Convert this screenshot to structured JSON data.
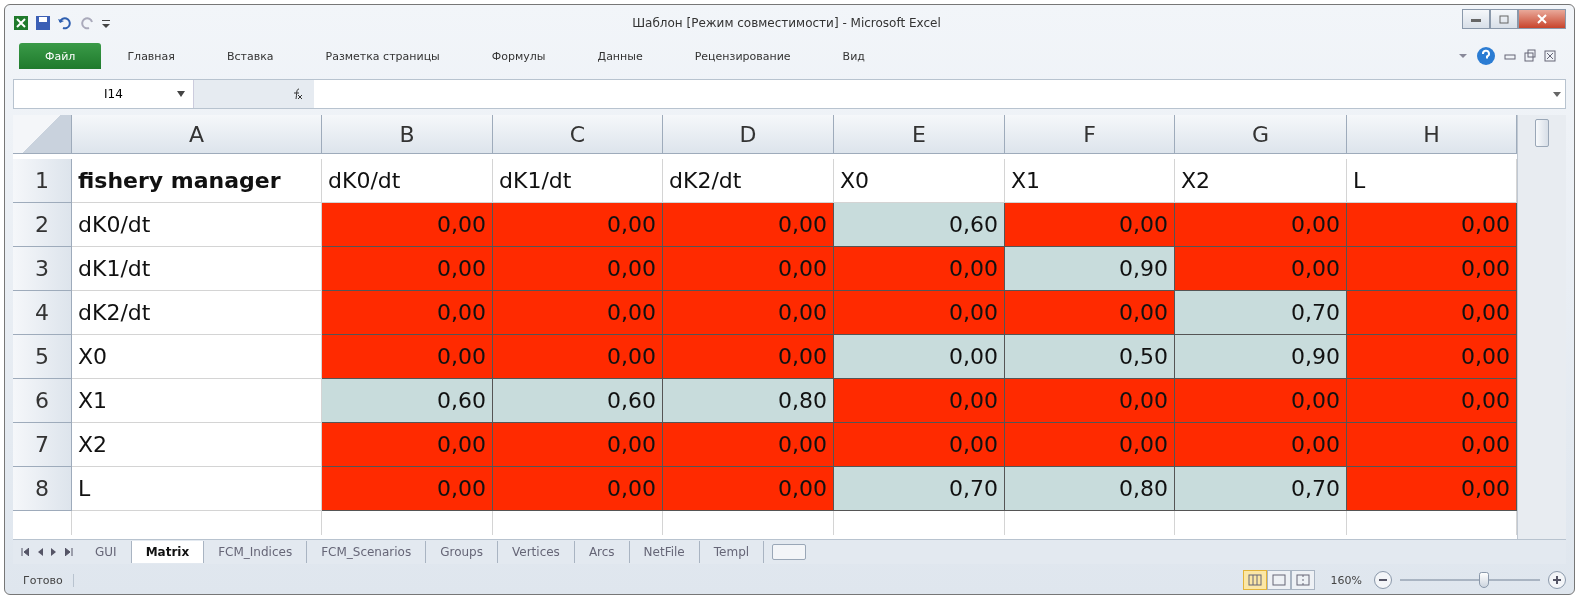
{
  "window": {
    "title": "Шаблон  [Режим совместимости]  -  Microsoft Excel"
  },
  "ribbon_tabs": [
    {
      "label": "Файл",
      "kind": "file"
    },
    {
      "label": "Главная",
      "kind": "tab"
    },
    {
      "label": "Вставка",
      "kind": "tab"
    },
    {
      "label": "Разметка страницы",
      "kind": "tab"
    },
    {
      "label": "Формулы",
      "kind": "tab"
    },
    {
      "label": "Данные",
      "kind": "tab"
    },
    {
      "label": "Рецензирование",
      "kind": "tab"
    },
    {
      "label": "Вид",
      "kind": "tab"
    }
  ],
  "formula_bar": {
    "name_box": "I14"
  },
  "columns": [
    "A",
    "B",
    "C",
    "D",
    "E",
    "F",
    "G",
    "H"
  ],
  "header_row": {
    "number": "1",
    "cells": [
      {
        "text": "fishery manager"
      },
      {
        "text": "dK0/dt"
      },
      {
        "text": "dK1/dt"
      },
      {
        "text": "dK2/dt"
      },
      {
        "text": "X0"
      },
      {
        "text": "X1"
      },
      {
        "text": "X2"
      },
      {
        "text": "L"
      }
    ]
  },
  "rows": [
    {
      "number": "2",
      "cells": [
        {
          "text": "dK0/dt"
        },
        {
          "text": "0,00",
          "color": "#ff2a00"
        },
        {
          "text": "0,00",
          "color": "#ff2a00"
        },
        {
          "text": "0,00",
          "color": "#ff2a00"
        },
        {
          "text": "0,60",
          "color": "#c8dcdc"
        },
        {
          "text": "0,00",
          "color": "#ff2a00"
        },
        {
          "text": "0,00",
          "color": "#ff2a00"
        },
        {
          "text": "0,00",
          "color": "#ff2a00"
        }
      ]
    },
    {
      "number": "3",
      "cells": [
        {
          "text": "dK1/dt"
        },
        {
          "text": "0,00",
          "color": "#ff2a00"
        },
        {
          "text": "0,00",
          "color": "#ff2a00"
        },
        {
          "text": "0,00",
          "color": "#ff2a00"
        },
        {
          "text": "0,00",
          "color": "#ff2a00"
        },
        {
          "text": "0,90",
          "color": "#c8dcdc"
        },
        {
          "text": "0,00",
          "color": "#ff2a00"
        },
        {
          "text": "0,00",
          "color": "#ff2a00"
        }
      ]
    },
    {
      "number": "4",
      "cells": [
        {
          "text": "dK2/dt"
        },
        {
          "text": "0,00",
          "color": "#ff2a00"
        },
        {
          "text": "0,00",
          "color": "#ff2a00"
        },
        {
          "text": "0,00",
          "color": "#ff2a00"
        },
        {
          "text": "0,00",
          "color": "#ff2a00"
        },
        {
          "text": "0,00",
          "color": "#ff2a00"
        },
        {
          "text": "0,70",
          "color": "#c8dcdc"
        },
        {
          "text": "0,00",
          "color": "#ff2a00"
        }
      ]
    },
    {
      "number": "5",
      "cells": [
        {
          "text": "X0"
        },
        {
          "text": "0,00",
          "color": "#ff2a00"
        },
        {
          "text": "0,00",
          "color": "#ff2a00"
        },
        {
          "text": "0,00",
          "color": "#ff2a00"
        },
        {
          "text": "0,00",
          "color": "#c8dcdc"
        },
        {
          "text": "0,50",
          "color": "#c8dcdc"
        },
        {
          "text": "0,90",
          "color": "#c8dcdc"
        },
        {
          "text": "0,00",
          "color": "#ff2a00"
        }
      ]
    },
    {
      "number": "6",
      "cells": [
        {
          "text": "X1"
        },
        {
          "text": "0,60",
          "color": "#c8dcdc"
        },
        {
          "text": "0,60",
          "color": "#c8dcdc"
        },
        {
          "text": "0,80",
          "color": "#c8dcdc"
        },
        {
          "text": "0,00",
          "color": "#ff2a00"
        },
        {
          "text": "0,00",
          "color": "#ff2a00"
        },
        {
          "text": "0,00",
          "color": "#ff2a00"
        },
        {
          "text": "0,00",
          "color": "#ff2a00"
        }
      ]
    },
    {
      "number": "7",
      "cells": [
        {
          "text": "X2"
        },
        {
          "text": "0,00",
          "color": "#ff2a00"
        },
        {
          "text": "0,00",
          "color": "#ff2a00"
        },
        {
          "text": "0,00",
          "color": "#ff2a00"
        },
        {
          "text": "0,00",
          "color": "#ff2a00"
        },
        {
          "text": "0,00",
          "color": "#ff2a00"
        },
        {
          "text": "0,00",
          "color": "#ff2a00"
        },
        {
          "text": "0,00",
          "color": "#ff2a00"
        }
      ]
    },
    {
      "number": "8",
      "cells": [
        {
          "text": "L"
        },
        {
          "text": "0,00",
          "color": "#ff2a00"
        },
        {
          "text": "0,00",
          "color": "#ff2a00"
        },
        {
          "text": "0,00",
          "color": "#ff2a00"
        },
        {
          "text": "0,70",
          "color": "#c8dcdc"
        },
        {
          "text": "0,80",
          "color": "#c8dcdc"
        },
        {
          "text": "0,70",
          "color": "#c8dcdc"
        },
        {
          "text": "0,00",
          "color": "#ff2a00"
        }
      ]
    }
  ],
  "sheet_tabs": [
    {
      "label": "GUI",
      "selected": false
    },
    {
      "label": "Matrix",
      "selected": true
    },
    {
      "label": "FCM_Indices",
      "selected": false
    },
    {
      "label": "FCM_Scenarios",
      "selected": false
    },
    {
      "label": "Groups",
      "selected": false
    },
    {
      "label": "Vertices",
      "selected": false
    },
    {
      "label": "Arcs",
      "selected": false
    },
    {
      "label": "NetFile",
      "selected": false
    },
    {
      "label": "Templ",
      "selected": false
    }
  ],
  "status_bar": {
    "status": "Готово",
    "views": [
      {
        "kind": "normal",
        "selected": true
      },
      {
        "kind": "layout",
        "selected": false
      },
      {
        "kind": "pagebreak",
        "selected": false
      }
    ],
    "zoom": "160%",
    "zoom_slider": {
      "level": 0.6
    }
  }
}
